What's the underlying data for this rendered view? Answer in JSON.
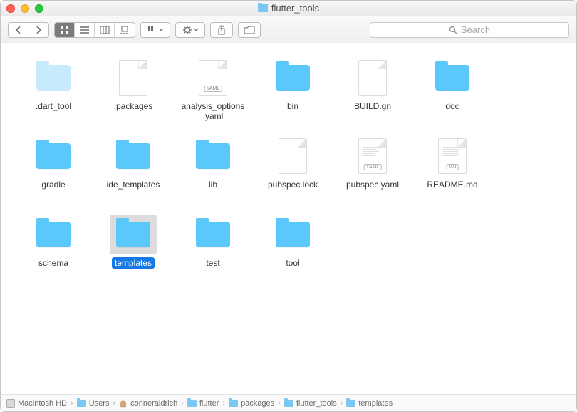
{
  "window": {
    "title": "flutter_tools"
  },
  "search": {
    "placeholder": "Search"
  },
  "items": [
    {
      "name": ".dart_tool",
      "type": "folder",
      "dim": true
    },
    {
      "name": ".packages",
      "type": "file",
      "tag": ""
    },
    {
      "name": "analysis_options.yaml",
      "type": "file",
      "tag": "YAML"
    },
    {
      "name": "bin",
      "type": "folder"
    },
    {
      "name": "BUILD.gn",
      "type": "file",
      "tag": ""
    },
    {
      "name": "doc",
      "type": "folder"
    },
    {
      "name": "gradle",
      "type": "folder"
    },
    {
      "name": "ide_templates",
      "type": "folder"
    },
    {
      "name": "lib",
      "type": "folder"
    },
    {
      "name": "pubspec.lock",
      "type": "file",
      "tag": ""
    },
    {
      "name": "pubspec.yaml",
      "type": "file",
      "tag": "YAML",
      "lines": true
    },
    {
      "name": "README.md",
      "type": "file",
      "tag": "MD",
      "lines": true
    },
    {
      "name": "schema",
      "type": "folder"
    },
    {
      "name": "templates",
      "type": "folder",
      "selected": true
    },
    {
      "name": "test",
      "type": "folder"
    },
    {
      "name": "tool",
      "type": "folder"
    }
  ],
  "path": [
    {
      "name": "Macintosh HD",
      "icon": "disk"
    },
    {
      "name": "Users",
      "icon": "folder"
    },
    {
      "name": "conneraldrich",
      "icon": "home"
    },
    {
      "name": "flutter",
      "icon": "folder"
    },
    {
      "name": "packages",
      "icon": "folder"
    },
    {
      "name": "flutter_tools",
      "icon": "folder"
    },
    {
      "name": "templates",
      "icon": "folder"
    }
  ]
}
